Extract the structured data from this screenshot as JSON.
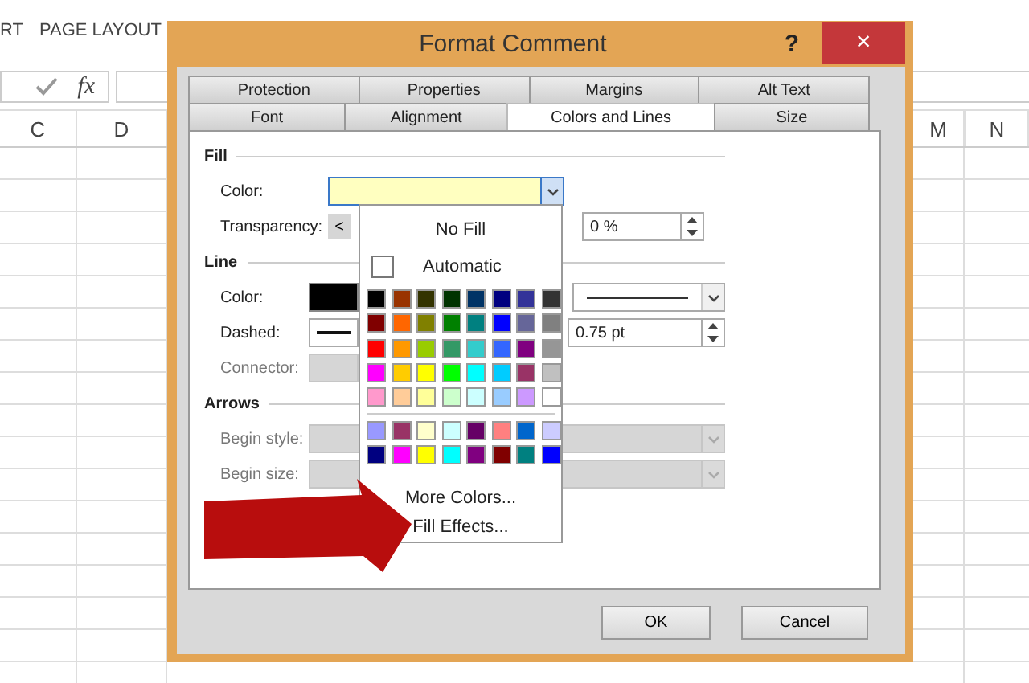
{
  "ribbon_tabs": [
    {
      "label": "RT"
    },
    {
      "label": "PAGE LAYOUT"
    }
  ],
  "formula_bar": {
    "function_label": "fx"
  },
  "column_headers": [
    {
      "label": "C"
    },
    {
      "label": "D"
    },
    {
      "label": "M"
    },
    {
      "label": "N"
    }
  ],
  "dialog": {
    "title": "Format Comment",
    "help": "?",
    "close": "×",
    "tab_rows": [
      [
        {
          "label": "Protection",
          "selected": false
        },
        {
          "label": "Properties",
          "selected": false
        },
        {
          "label": "Margins",
          "selected": false
        },
        {
          "label": "Alt Text",
          "selected": false
        }
      ],
      [
        {
          "label": "Font",
          "selected": false
        },
        {
          "label": "Alignment",
          "selected": false
        },
        {
          "label": "Colors and Lines",
          "selected": true
        },
        {
          "label": "Size",
          "selected": false
        }
      ]
    ],
    "sections": [
      {
        "heading": "Fill",
        "kind": "fill",
        "rows": [
          {
            "kind": "color-dropdown",
            "label": "Color:",
            "color": "#ffffc0",
            "disabled": false
          },
          {
            "kind": "slider",
            "label": "Transparency:",
            "arrow": "<",
            "value": "0 %",
            "disabled": false
          }
        ]
      },
      {
        "heading": "Line",
        "kind": "line",
        "rows": [
          {
            "kind": "line-color",
            "label": "Color:",
            "color": "#000000",
            "disabled": false
          },
          {
            "kind": "dashed",
            "label": "Dashed:",
            "value": "0.75 pt",
            "disabled": false
          },
          {
            "kind": "plain",
            "label": "Connector:",
            "disabled": true
          }
        ]
      },
      {
        "heading": "Arrows",
        "kind": "arrows",
        "rows": [
          {
            "kind": "wide-dropdown",
            "label": "Begin style:",
            "disabled": true
          },
          {
            "kind": "wide-dropdown",
            "label": "Begin size:",
            "disabled": true
          }
        ]
      }
    ],
    "color_menu": {
      "no_fill": "No Fill",
      "automatic": "Automatic",
      "standard_rows": [
        {
          "swatches": [
            {
              "color": "#000000"
            },
            {
              "color": "#993300"
            },
            {
              "color": "#333300"
            },
            {
              "color": "#003300"
            },
            {
              "color": "#003366"
            },
            {
              "color": "#000080"
            },
            {
              "color": "#333399"
            },
            {
              "color": "#333333"
            }
          ]
        },
        {
          "swatches": [
            {
              "color": "#800000"
            },
            {
              "color": "#ff6600"
            },
            {
              "color": "#808000"
            },
            {
              "color": "#008000"
            },
            {
              "color": "#008080"
            },
            {
              "color": "#0000ff"
            },
            {
              "color": "#666699"
            },
            {
              "color": "#808080"
            }
          ]
        },
        {
          "swatches": [
            {
              "color": "#ff0000"
            },
            {
              "color": "#ff9900"
            },
            {
              "color": "#99cc00"
            },
            {
              "color": "#339966"
            },
            {
              "color": "#33cccc"
            },
            {
              "color": "#3366ff"
            },
            {
              "color": "#800080"
            },
            {
              "color": "#969696"
            }
          ]
        },
        {
          "swatches": [
            {
              "color": "#ff00ff"
            },
            {
              "color": "#ffcc00"
            },
            {
              "color": "#ffff00"
            },
            {
              "color": "#00ff00"
            },
            {
              "color": "#00ffff"
            },
            {
              "color": "#00ccff"
            },
            {
              "color": "#993366"
            },
            {
              "color": "#c0c0c0"
            }
          ]
        },
        {
          "swatches": [
            {
              "color": "#ff99cc"
            },
            {
              "color": "#ffcc99"
            },
            {
              "color": "#ffff99"
            },
            {
              "color": "#ccffcc"
            },
            {
              "color": "#ccffff"
            },
            {
              "color": "#99ccff"
            },
            {
              "color": "#cc99ff"
            },
            {
              "color": "#ffffff"
            }
          ]
        }
      ],
      "extra_rows": [
        {
          "swatches": [
            {
              "color": "#9999ff"
            },
            {
              "color": "#993366"
            },
            {
              "color": "#ffffcc"
            },
            {
              "color": "#ccffff"
            },
            {
              "color": "#660066"
            },
            {
              "color": "#ff8080"
            },
            {
              "color": "#0066cc"
            },
            {
              "color": "#ccccff"
            }
          ]
        },
        {
          "swatches": [
            {
              "color": "#000080"
            },
            {
              "color": "#ff00ff"
            },
            {
              "color": "#ffff00"
            },
            {
              "color": "#00ffff"
            },
            {
              "color": "#800080"
            },
            {
              "color": "#800000"
            },
            {
              "color": "#008080"
            },
            {
              "color": "#0000ff"
            }
          ]
        }
      ],
      "more_colors": "More Colors...",
      "fill_effects": "Fill Effects..."
    },
    "buttons": [
      {
        "label": "OK"
      },
      {
        "label": "Cancel"
      }
    ]
  }
}
